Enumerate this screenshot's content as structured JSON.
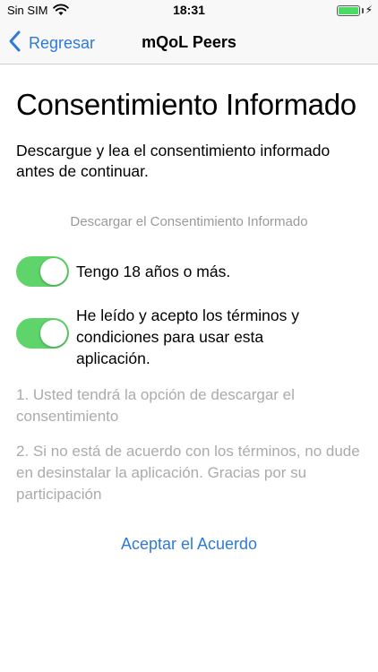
{
  "status_bar": {
    "carrier": "Sin SIM",
    "time": "18:31",
    "battery_level": 1.0
  },
  "nav": {
    "back_label": "Regresar",
    "title": "mQoL Peers",
    "back_icon": "chevron-left-icon"
  },
  "content": {
    "title": "Consentimiento Informado",
    "intro": "Descargue y lea el consentimiento informado antes de continuar.",
    "download_link": "Descargar el Consentimiento Informado",
    "toggles": [
      {
        "label": "Tengo 18 años o más.",
        "on": true
      },
      {
        "label": "He leído y acepto los términos y condiciones para usar esta aplicación.",
        "on": true
      }
    ],
    "notes": [
      "1. Usted tendrá la opción de descargar el consentimiento",
      "2. Si no está de acuerdo con los términos, no dude en desinstalar la aplicación. Gracias por su participación"
    ],
    "accept_label": "Aceptar el Acuerdo"
  },
  "colors": {
    "accent": "#2f7ad8",
    "switch_on": "#5fd46a",
    "muted_text": "#ababab",
    "battery": "#4cd964"
  }
}
